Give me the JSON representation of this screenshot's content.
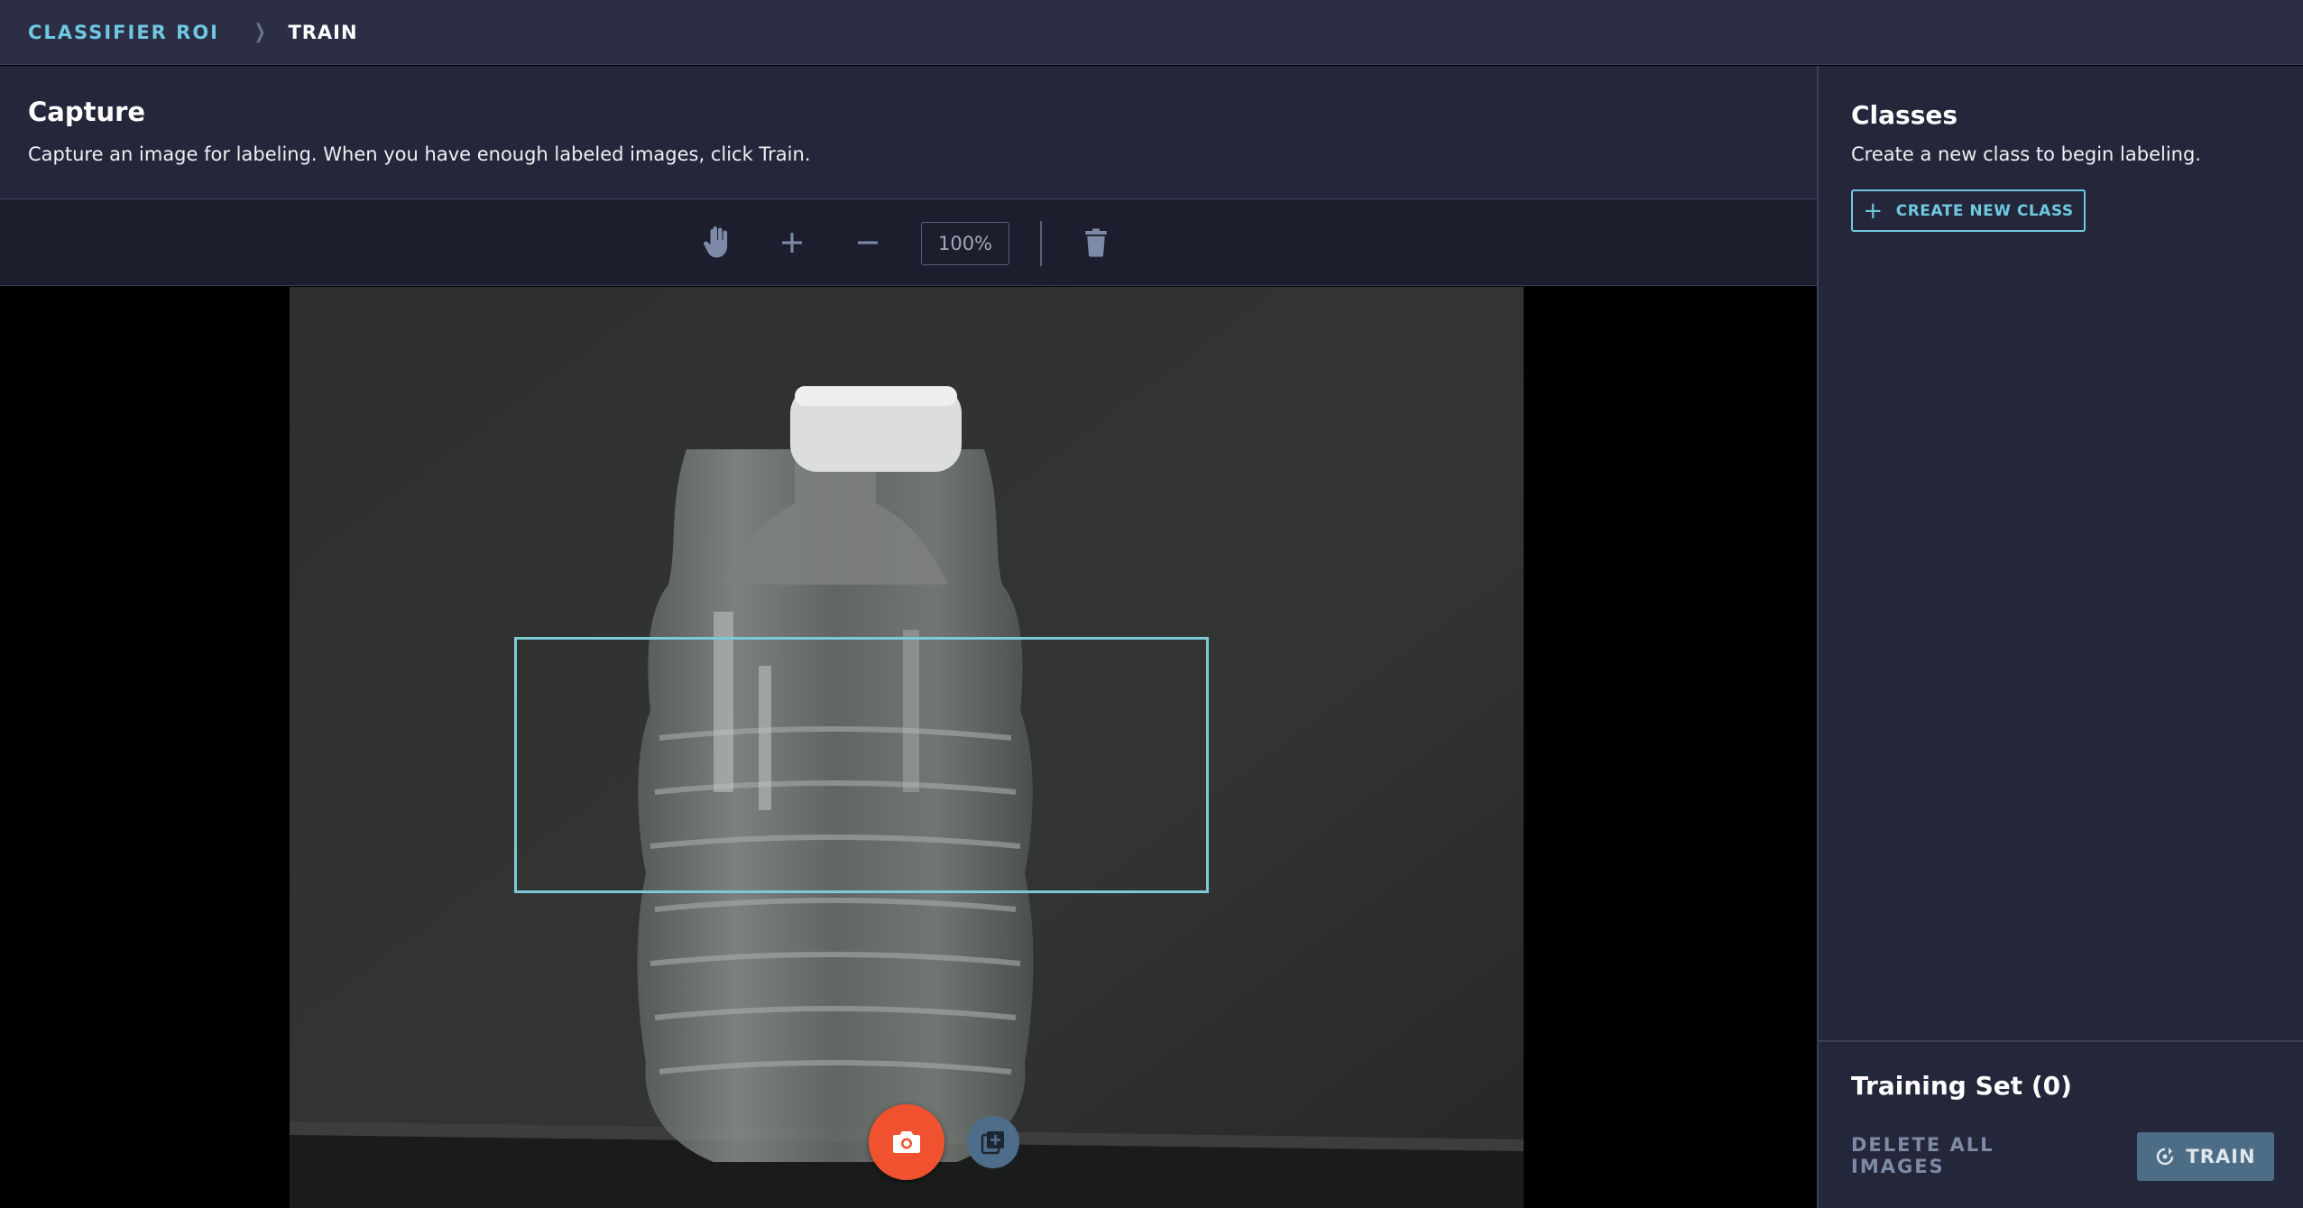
{
  "breadcrumb": {
    "root": "CLASSIFIER ROI",
    "separator_icon": "chevron-right-icon",
    "current": "TRAIN"
  },
  "capture": {
    "title": "Capture",
    "description": "Capture an image for labeling. When you have enough labeled images, click Train."
  },
  "toolbar": {
    "pan_icon": "hand-icon",
    "zoom_in_icon": "plus-icon",
    "zoom_out_icon": "minus-icon",
    "zoom_level": "100%",
    "delete_icon": "trash-icon"
  },
  "viewer": {
    "capture_button_icon": "camera-icon",
    "add_image_button_icon": "add-image-icon"
  },
  "classes": {
    "title": "Classes",
    "description": "Create a new class to begin labeling.",
    "create_button_label": "CREATE NEW CLASS"
  },
  "training_set": {
    "title": "Training Set (0)",
    "delete_all_label": "DELETE ALL IMAGES",
    "train_label": "TRAIN"
  },
  "colors": {
    "accent": "#6fc8e0",
    "capture_button": "#f0512e",
    "train_button": "#4d6c86",
    "roi_outline": "#7ccad6"
  }
}
